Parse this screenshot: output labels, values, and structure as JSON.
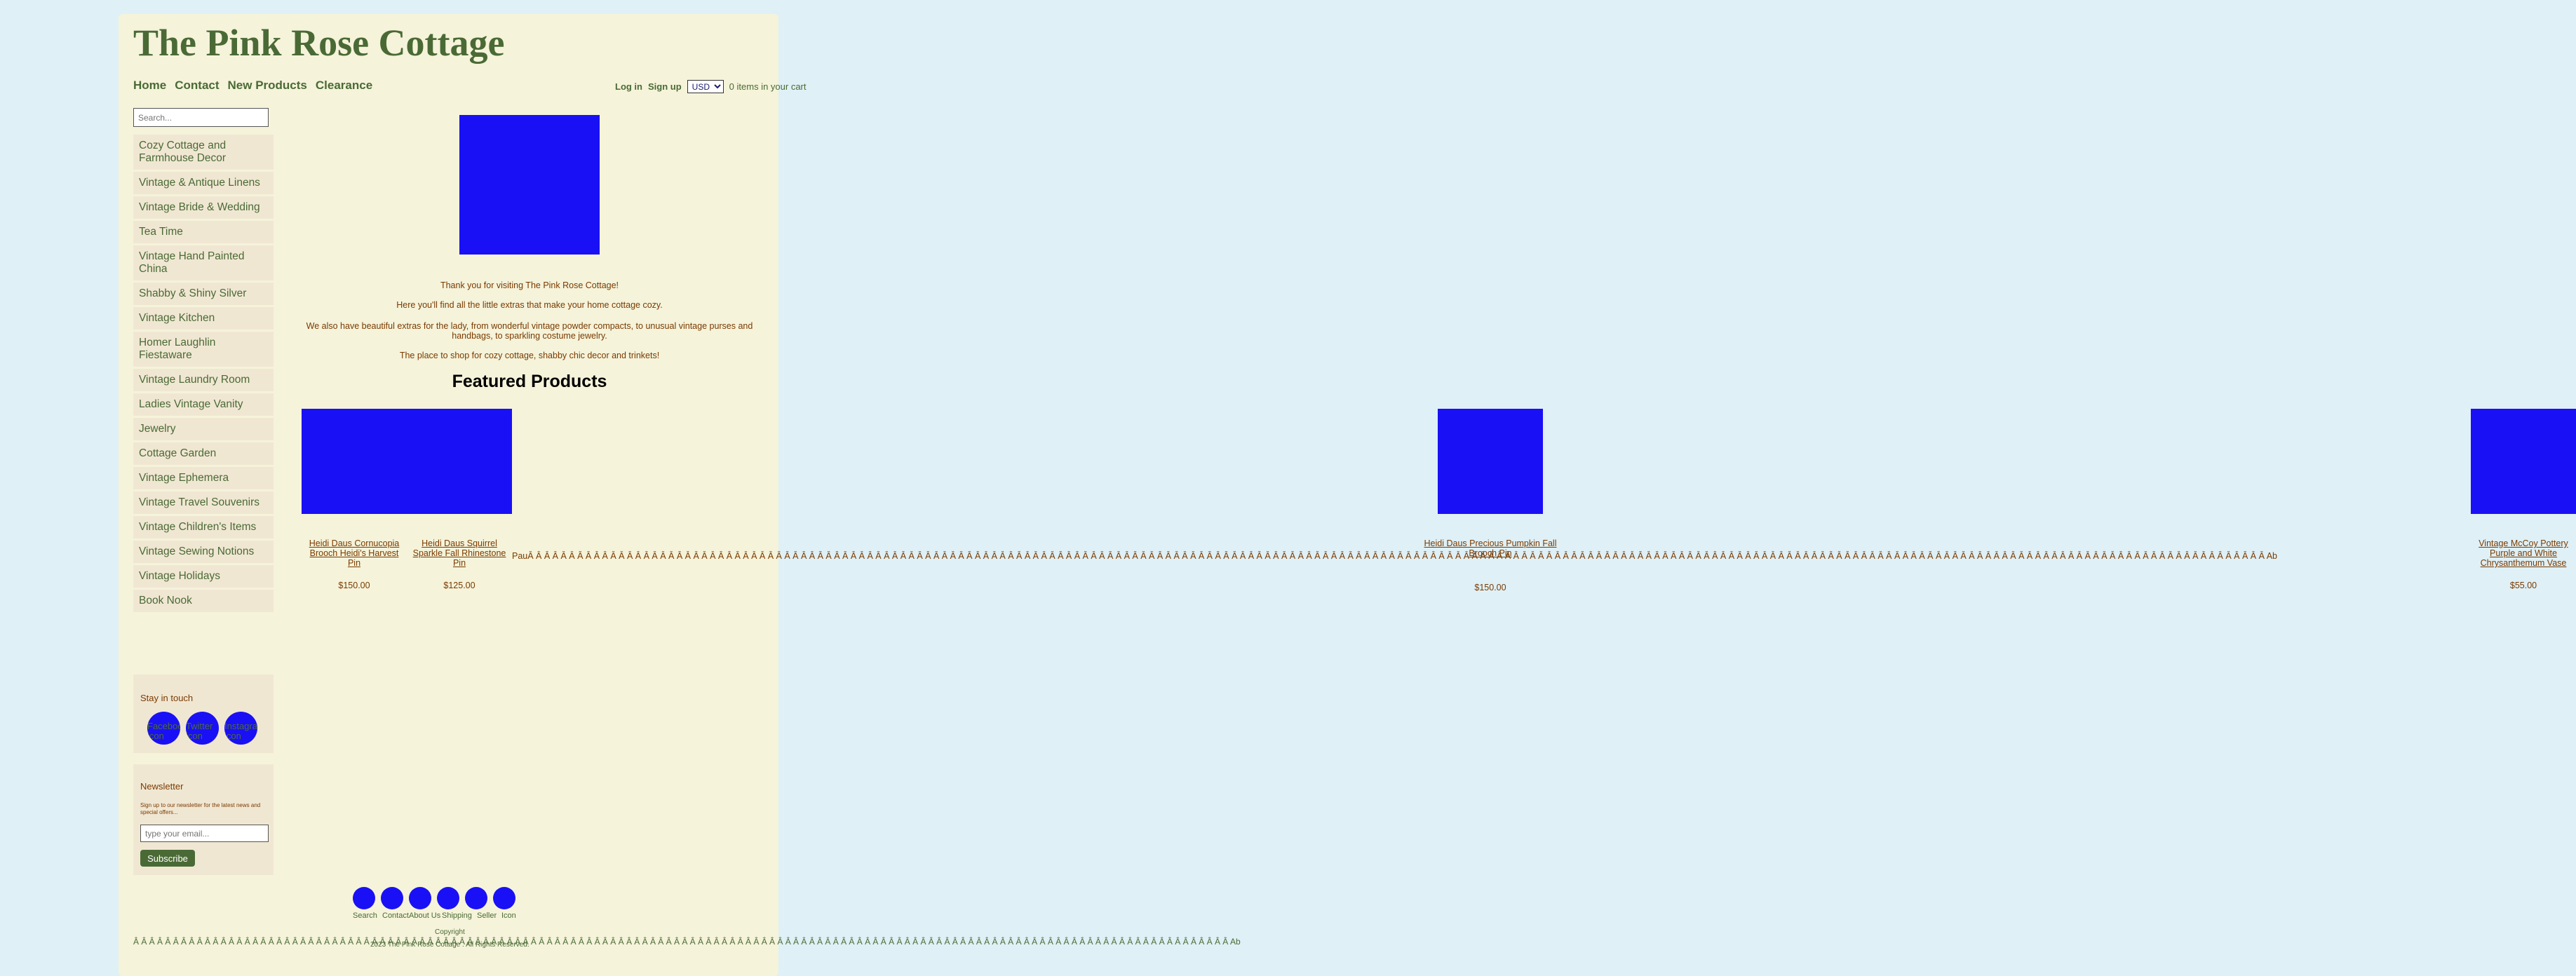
{
  "site": {
    "title": "The Pink Rose Cottage"
  },
  "mainnav": [
    "Home",
    "Contact",
    "New Products",
    "Clearance"
  ],
  "account": {
    "login": "Log in",
    "signup": "Sign up",
    "currency": "USD",
    "cart": "0 items in your cart"
  },
  "search": {
    "placeholder": "Search..."
  },
  "categories": [
    "Cozy Cottage and Farmhouse Decor",
    "Vintage & Antique Linens",
    "Vintage Bride & Wedding",
    "Tea Time",
    "Vintage Hand Painted China",
    "Shabby & Shiny Silver",
    "Vintage Kitchen",
    "Homer Laughlin Fiestaware",
    "Vintage Laundry Room",
    "Ladies Vintage Vanity",
    "Jewelry",
    "Cottage Garden",
    "Vintage Ephemera",
    "Vintage Travel Souvenirs",
    "Vintage Children's Items",
    "Vintage Sewing Notions",
    "Vintage Holidays",
    "Book Nook"
  ],
  "stay": {
    "heading": "Stay in touch",
    "icons": [
      {
        "alt": "Facebook icon",
        "icon": "facebook-icon"
      },
      {
        "alt": "Twitter icon",
        "icon": "twitter-icon"
      },
      {
        "alt": "Instagram icon",
        "icon": "instagram-icon"
      }
    ]
  },
  "newsletter": {
    "heading": "Newsletter",
    "text": "Sign up to our newsletter for the latest news and special offers...",
    "placeholder": "type your email...",
    "button": "Subscribe"
  },
  "intro": [
    "Thank you for visiting The Pink Rose Cottage!",
    "Here you'll find all the little extras that make your home cottage cozy.",
    "We also have beautiful extras for the lady, from wonderful vintage powder compacts, to unusual vintage purses and handbags, to sparkling costume jewelry.",
    "The place to shop for cozy cottage, shabby chic decor and trinkets!"
  ],
  "featured_heading": "Featured Products",
  "products": [
    {
      "title": "Heidi Daus Cornucopia Brooch Heidi's Harvest Pin",
      "price": "$150.00"
    },
    {
      "title": "Heidi Daus Squirrel Sparkle Fall Rhinestone Pin",
      "price": "$125.00"
    },
    {
      "title": "Heidi Daus Precious Pumpkin Fall Brooch Pin",
      "price": "$150.00"
    },
    {
      "title": "Vintage McCoy Pottery Purple and White Chrysanthemum Vase",
      "price": "$55.00"
    }
  ],
  "products_artifact": "PauÂ  Â  Â  Â  Â  Â  Â  Â  Â  Â  Â  Â  Â  Â  Â  Â  Â  Â  Â  Â  Â  Â  Â  Â  Â  Â  Â  Â  Â  Â  Â  Â  Â  Â  Â  Â  Â  Â  Â  Â  Â  Â  Â  Â  Â  Â  Â  Â  Â  Â  Â  Â  Â  Â  Â  Â  Â  Â  Â  Â  Â  Â  Â  Â  Â  Â  Â  Â  Â  Â  Â  Â  Â  Â  Â  Â  Â  Â  Â  Â  Â  Â  Â  Â  Â  Â  Â  Â  Â  Â  Â  Â  Â  Â  Â  Â  Â  Â  Â  Â  Â  Â  Â  Â  Â  Â  Â  Â  Â  Â  Â  Â  Â  Â  Â  Â  Â  Â  Â  Â  Â  Â  Â  Â  Â  Â  Â  Â  Â  Â  Â  Â  Â  Â  Â  Â  Â  Â  Â  Â  Â  Â  Â  Â  Â  Â  Â  Â  Â  Â  Â  Â  Â  Â  Â  Â  Â  Â  Â  Â  Â  Â  Â  Â  Â  Â  Â  Â  Â  Â  Â  Â  Â  Â  Â  Â  Â  Â  Â  Â  Â  Â  Â  Â  Â  Â  Â  Â  Â  Â  Â  Â  Â  Â  Â  Â  Â  Â  Â  Â  Â  Â  Â  Â  Â  Â  Â  Â  Â  Â  Ab",
  "footer": {
    "links": [
      "Search",
      "Contact",
      "About Us",
      "Shipping",
      "Seller",
      "Icon"
    ],
    "copyright_label": "Copyright",
    "copyright": "2023 The Pink Rose Cottage . All Rights Reserved.",
    "artifact": "Â  Â  Â  Â  Â  Â  Â  Â  Â  Â  Â  Â  Â  Â  Â  Â  Â  Â  Â  Â  Â  Â  Â  Â  Â  Â  Â  Â  Â  Â  Â  Â  Â  Â  Â  Â  Â  Â  Â  Â  Â  Â  Â  Â  Â  Â  Â  Â  Â  Â  Â  Â  Â  Â  Â  Â  Â  Â  Â  Â  Â  Â  Â  Â  Â  Â  Â  Â  Â  Â  Â  Â  Â  Â  Â  Â  Â  Â  Â  Â  Â  Â  Â  Â  Â  Â  Â  Â  Â  Â  Â  Â  Â  Â  Â  Â  Â  Â  Â  Â  Â  Â  Â  Â  Â  Â  Â  Â  Â  Â  Â  Â  Â  Â  Â  Â  Â  Â  Â  Â  Â  Â  Â  Â  Â  Â  Â  Â  Â  Â  Â  Â  Â  Â  Â  Â  Â  Â  Ab"
  },
  "colors": {
    "page_bg": "#dff0f6",
    "card_bg": "#f5f3da",
    "nav_item_bg": "#f0e7d3",
    "brand_green": "#4a6a35",
    "text_brown": "#7a3a00",
    "image_placeholder": "#1a10f5"
  }
}
